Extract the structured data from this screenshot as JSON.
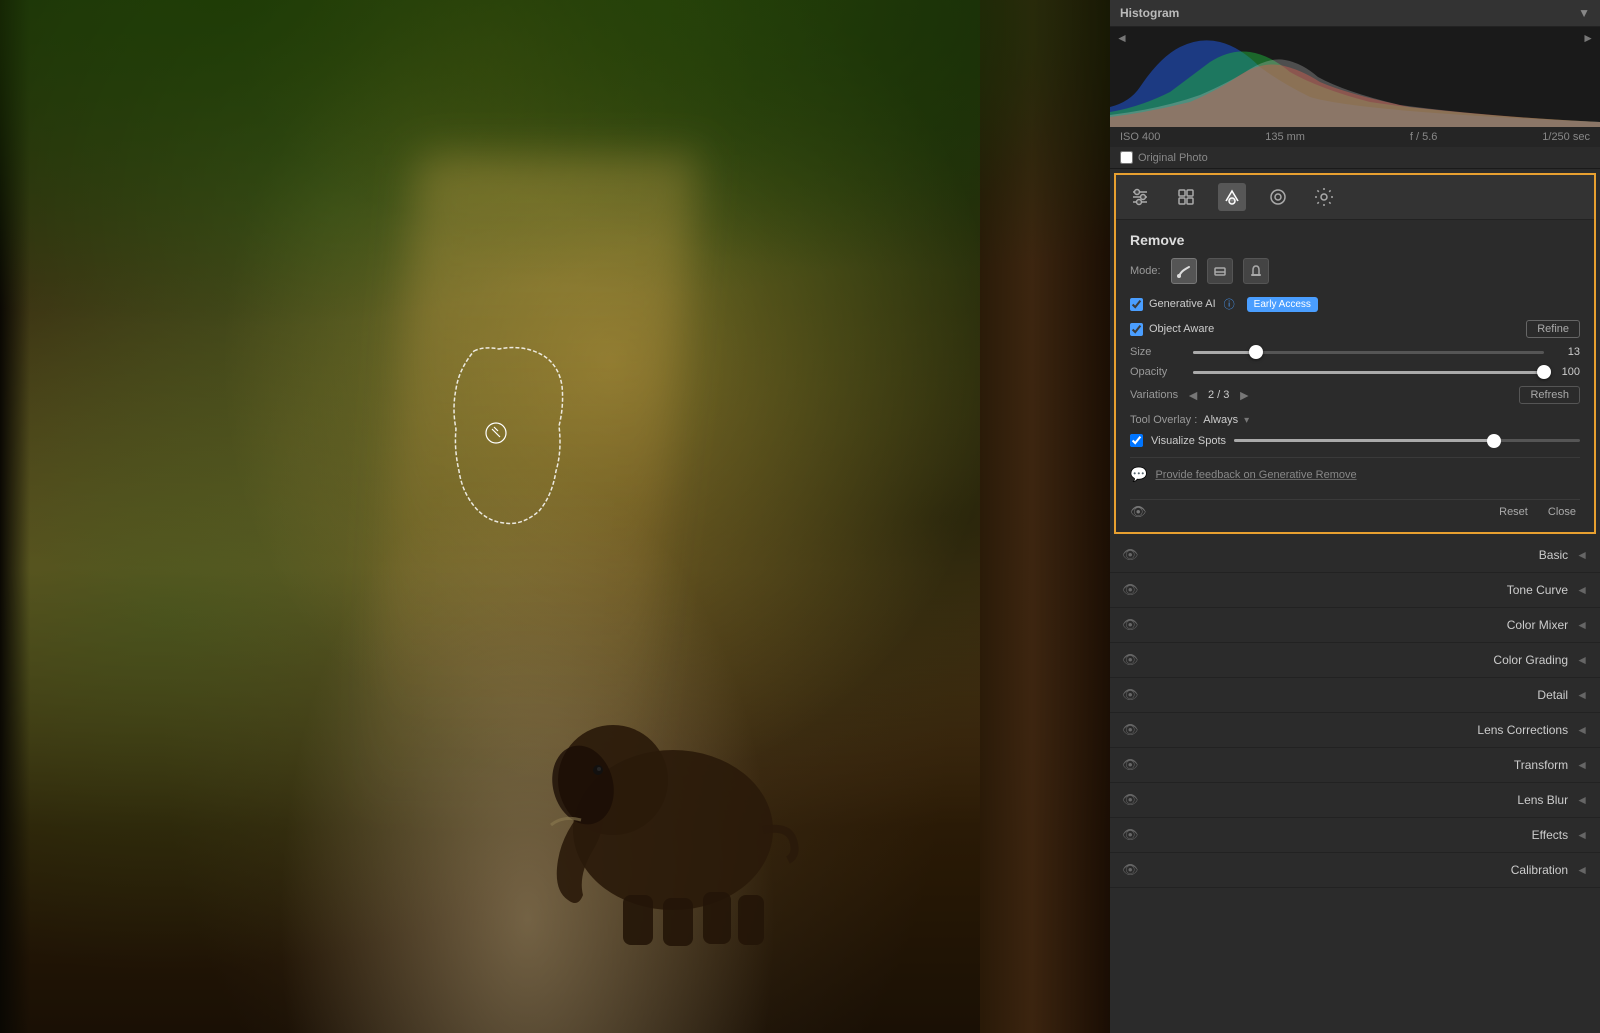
{
  "histogram": {
    "title": "Histogram",
    "iso": "ISO 400",
    "focal": "135 mm",
    "aperture": "f / 5.6",
    "shutter": "1/250 sec",
    "original_photo_label": "Original Photo"
  },
  "tools": {
    "icons": [
      {
        "name": "sliders-icon",
        "glyph": "⊞",
        "label": "Adjustments"
      },
      {
        "name": "presets-icon",
        "glyph": "✦",
        "label": "Presets"
      },
      {
        "name": "healing-icon",
        "glyph": "✎",
        "label": "Healing",
        "active": true
      },
      {
        "name": "masking-icon",
        "glyph": "◎",
        "label": "Masking"
      },
      {
        "name": "settings-icon",
        "glyph": "⚙",
        "label": "Settings"
      }
    ]
  },
  "remove_panel": {
    "title": "Remove",
    "mode_label": "Mode:",
    "modes": [
      {
        "name": "brush-mode",
        "glyph": "◈",
        "active": true
      },
      {
        "name": "eraser-mode",
        "glyph": "⌫"
      },
      {
        "name": "move-mode",
        "glyph": "⬆"
      }
    ],
    "generative_ai": {
      "label": "Generative AI",
      "badge": "Early Access"
    },
    "object_aware": {
      "label": "Object Aware",
      "refine_label": "Refine"
    },
    "size": {
      "label": "Size",
      "value": 13,
      "percent": 18
    },
    "opacity": {
      "label": "Opacity",
      "value": 100,
      "percent": 100
    },
    "variations": {
      "label": "Variations",
      "current": 2,
      "total": 3,
      "refresh_label": "Refresh"
    },
    "tool_overlay": {
      "label": "Tool Overlay :",
      "value": "Always",
      "arrow": "▾"
    },
    "visualize_spots": {
      "label": "Visualize Spots",
      "percent": 75
    },
    "feedback": {
      "label": "Provide feedback on Generative Remove"
    },
    "reset_label": "Reset",
    "close_label": "Close"
  },
  "panel_items": [
    {
      "name": "basic",
      "label": "Basic",
      "has_arrow": true
    },
    {
      "name": "tone-curve",
      "label": "Tone Curve",
      "has_arrow": true
    },
    {
      "name": "color-mixer",
      "label": "Color Mixer",
      "has_arrow": true
    },
    {
      "name": "color-grading",
      "label": "Color Grading",
      "has_arrow": true
    },
    {
      "name": "detail",
      "label": "Detail",
      "has_arrow": true
    },
    {
      "name": "lens-corrections",
      "label": "Lens Corrections",
      "has_arrow": true
    },
    {
      "name": "transform",
      "label": "Transform",
      "has_arrow": true
    },
    {
      "name": "lens-blur",
      "label": "Lens Blur",
      "has_arrow": true
    },
    {
      "name": "effects",
      "label": "Effects",
      "has_arrow": true
    },
    {
      "name": "calibration",
      "label": "Calibration",
      "has_arrow": true
    }
  ],
  "colors": {
    "accent_orange": "#e8a030",
    "accent_blue": "#4a9eff"
  }
}
